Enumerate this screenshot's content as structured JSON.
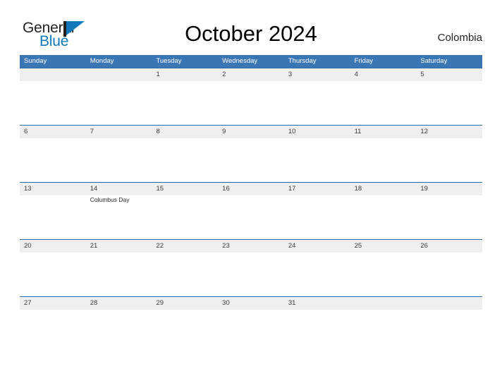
{
  "brand": {
    "name_part1": "General",
    "name_part2": "Blue",
    "accent_color": "#1278be"
  },
  "header": {
    "title": "October 2024",
    "country": "Colombia"
  },
  "calendar": {
    "header_color": "#3b76b4",
    "weekdays": [
      "Sunday",
      "Monday",
      "Tuesday",
      "Wednesday",
      "Thursday",
      "Friday",
      "Saturday"
    ],
    "weeks": [
      [
        {
          "date": ""
        },
        {
          "date": ""
        },
        {
          "date": "1"
        },
        {
          "date": "2"
        },
        {
          "date": "3"
        },
        {
          "date": "4"
        },
        {
          "date": "5"
        }
      ],
      [
        {
          "date": "6"
        },
        {
          "date": "7"
        },
        {
          "date": "8"
        },
        {
          "date": "9"
        },
        {
          "date": "10"
        },
        {
          "date": "11"
        },
        {
          "date": "12"
        }
      ],
      [
        {
          "date": "13"
        },
        {
          "date": "14",
          "events": [
            "Columbus Day"
          ]
        },
        {
          "date": "15"
        },
        {
          "date": "16"
        },
        {
          "date": "17"
        },
        {
          "date": "18"
        },
        {
          "date": "19"
        }
      ],
      [
        {
          "date": "20"
        },
        {
          "date": "21"
        },
        {
          "date": "22"
        },
        {
          "date": "23"
        },
        {
          "date": "24"
        },
        {
          "date": "25"
        },
        {
          "date": "26"
        }
      ],
      [
        {
          "date": "27"
        },
        {
          "date": "28"
        },
        {
          "date": "29"
        },
        {
          "date": "30"
        },
        {
          "date": "31"
        },
        {
          "date": ""
        },
        {
          "date": ""
        }
      ]
    ]
  }
}
